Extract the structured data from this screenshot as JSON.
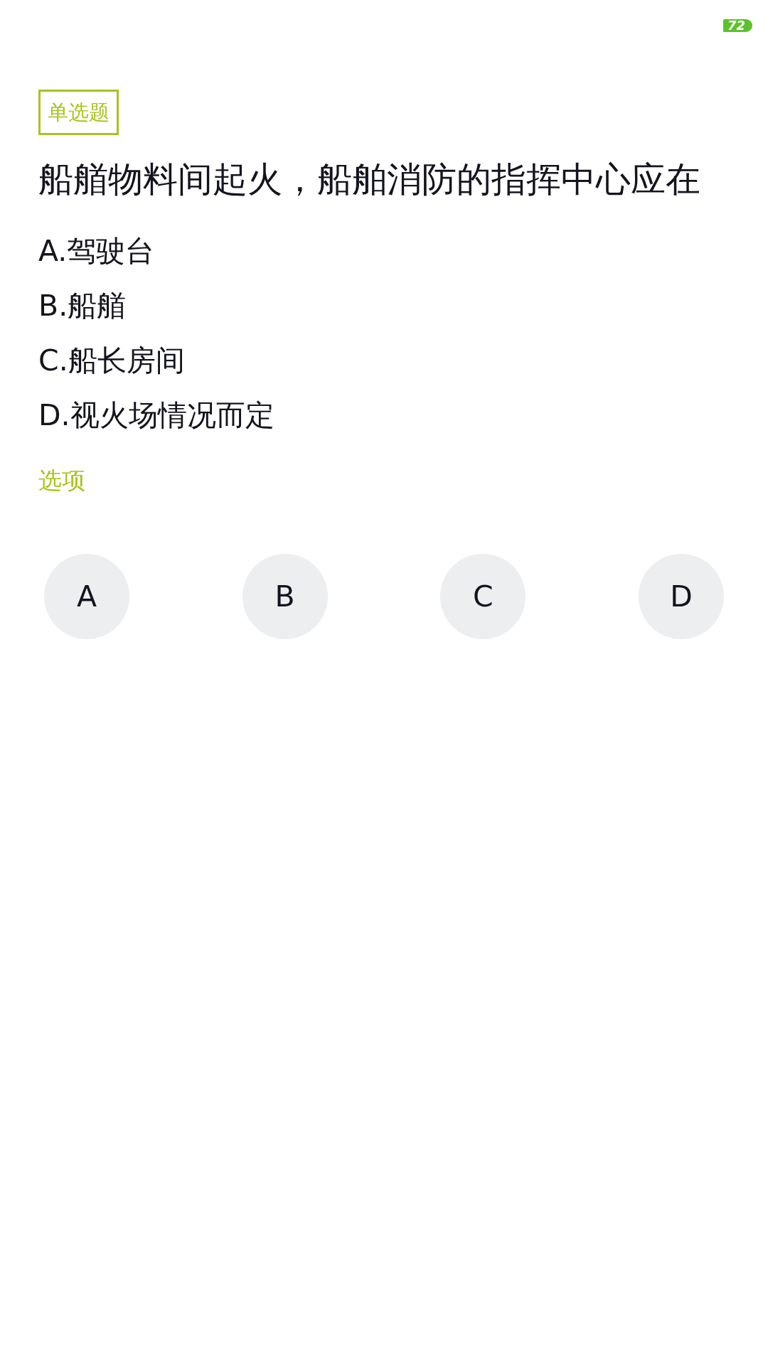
{
  "status_bar": {
    "battery": "72"
  },
  "question": {
    "type_tag": "单选题",
    "text": "船艏物料间起火，船舶消防的指挥中心应在",
    "options": [
      "A.驾驶台",
      "B.船艏",
      "C.船长房间",
      "D.视火场情况而定"
    ]
  },
  "answer_section": {
    "label": "选项",
    "choices": [
      {
        "label": "A",
        "selected": false
      },
      {
        "label": "B",
        "selected": false
      },
      {
        "label": "C",
        "selected": false
      },
      {
        "label": "D",
        "selected": false
      }
    ]
  }
}
